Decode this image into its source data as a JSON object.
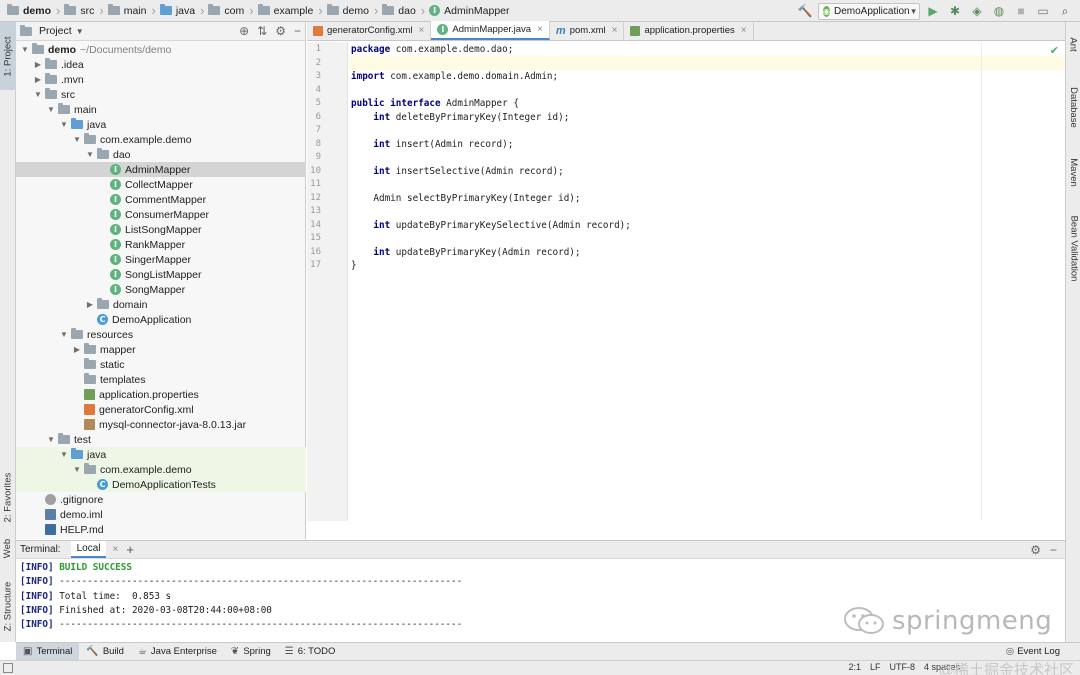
{
  "breadcrumbs": [
    "demo",
    "src",
    "main",
    "java",
    "com",
    "example",
    "demo",
    "dao",
    "AdminMapper"
  ],
  "run_config": "DemoApplication",
  "left_strip": {
    "project": "1: Project",
    "favorites": "2: Favorites",
    "web": "Web",
    "structure": "Z: Structure"
  },
  "right_strip": {
    "ant": "Ant",
    "database": "Database",
    "maven": "Maven",
    "bean": "Bean Validation"
  },
  "project_panel": {
    "title": "Project"
  },
  "tree": [
    {
      "label": "demo",
      "path": "~/Documents/demo",
      "indent": 0,
      "toggle": "open",
      "icon": "folder",
      "bold": true
    },
    {
      "label": ".idea",
      "indent": 1,
      "toggle": "closed",
      "icon": "folder"
    },
    {
      "label": ".mvn",
      "indent": 1,
      "toggle": "closed",
      "icon": "folder"
    },
    {
      "label": "src",
      "indent": 1,
      "toggle": "open",
      "icon": "folder"
    },
    {
      "label": "main",
      "indent": 2,
      "toggle": "open",
      "icon": "folder"
    },
    {
      "label": "java",
      "indent": 3,
      "toggle": "open",
      "icon": "folder-blue"
    },
    {
      "label": "com.example.demo",
      "indent": 4,
      "toggle": "open",
      "icon": "folder-pkg"
    },
    {
      "label": "dao",
      "indent": 5,
      "toggle": "open",
      "icon": "folder-pkg"
    },
    {
      "label": "AdminMapper",
      "indent": 6,
      "toggle": "none",
      "icon": "interface",
      "selected": true
    },
    {
      "label": "CollectMapper",
      "indent": 6,
      "toggle": "none",
      "icon": "interface"
    },
    {
      "label": "CommentMapper",
      "indent": 6,
      "toggle": "none",
      "icon": "interface"
    },
    {
      "label": "ConsumerMapper",
      "indent": 6,
      "toggle": "none",
      "icon": "interface"
    },
    {
      "label": "ListSongMapper",
      "indent": 6,
      "toggle": "none",
      "icon": "interface"
    },
    {
      "label": "RankMapper",
      "indent": 6,
      "toggle": "none",
      "icon": "interface"
    },
    {
      "label": "SingerMapper",
      "indent": 6,
      "toggle": "none",
      "icon": "interface"
    },
    {
      "label": "SongListMapper",
      "indent": 6,
      "toggle": "none",
      "icon": "interface"
    },
    {
      "label": "SongMapper",
      "indent": 6,
      "toggle": "none",
      "icon": "interface"
    },
    {
      "label": "domain",
      "indent": 5,
      "toggle": "closed",
      "icon": "folder-pkg"
    },
    {
      "label": "DemoApplication",
      "indent": 5,
      "toggle": "none",
      "icon": "class"
    },
    {
      "label": "resources",
      "indent": 3,
      "toggle": "open",
      "icon": "folder"
    },
    {
      "label": "mapper",
      "indent": 4,
      "toggle": "closed",
      "icon": "folder"
    },
    {
      "label": "static",
      "indent": 4,
      "toggle": "none",
      "icon": "folder"
    },
    {
      "label": "templates",
      "indent": 4,
      "toggle": "none",
      "icon": "folder"
    },
    {
      "label": "application.properties",
      "indent": 4,
      "toggle": "none",
      "icon": "properties"
    },
    {
      "label": "generatorConfig.xml",
      "indent": 4,
      "toggle": "none",
      "icon": "xml"
    },
    {
      "label": "mysql-connector-java-8.0.13.jar",
      "indent": 4,
      "toggle": "none",
      "icon": "jar"
    },
    {
      "label": "test",
      "indent": 2,
      "toggle": "open",
      "icon": "folder"
    },
    {
      "label": "java",
      "indent": 3,
      "toggle": "open",
      "icon": "folder-blue",
      "test": true
    },
    {
      "label": "com.example.demo",
      "indent": 4,
      "toggle": "open",
      "icon": "folder-pkg",
      "test": true
    },
    {
      "label": "DemoApplicationTests",
      "indent": 5,
      "toggle": "none",
      "icon": "class",
      "test": true
    },
    {
      "label": ".gitignore",
      "indent": 1,
      "toggle": "none",
      "icon": "git"
    },
    {
      "label": "demo.iml",
      "indent": 1,
      "toggle": "none",
      "icon": "iml"
    },
    {
      "label": "HELP.md",
      "indent": 1,
      "toggle": "none",
      "icon": "md"
    }
  ],
  "editor_tabs": [
    {
      "label": "generatorConfig.xml",
      "icon": "xml",
      "active": false
    },
    {
      "label": "AdminMapper.java",
      "icon": "interface",
      "active": true
    },
    {
      "label": "pom.xml",
      "icon": "maven",
      "active": false
    },
    {
      "label": "application.properties",
      "icon": "properties",
      "active": false
    }
  ],
  "code_lines": [
    [
      {
        "t": "package",
        "kw": true
      },
      {
        "t": " com.example.demo.dao;"
      }
    ],
    [],
    [
      {
        "t": "import",
        "kw": true
      },
      {
        "t": " com.example.demo.domain.Admin;"
      }
    ],
    [],
    [
      {
        "t": "public",
        "kw": true
      },
      {
        "t": " "
      },
      {
        "t": "interface",
        "kw": true
      },
      {
        "t": " AdminMapper {"
      }
    ],
    [
      {
        "t": "    "
      },
      {
        "t": "int",
        "kw": true
      },
      {
        "t": " deleteByPrimaryKey(Integer id);"
      }
    ],
    [],
    [
      {
        "t": "    "
      },
      {
        "t": "int",
        "kw": true
      },
      {
        "t": " insert(Admin record);"
      }
    ],
    [],
    [
      {
        "t": "    "
      },
      {
        "t": "int",
        "kw": true
      },
      {
        "t": " insertSelective(Admin record);"
      }
    ],
    [],
    [
      {
        "t": "    Admin selectByPrimaryKey(Integer id);"
      }
    ],
    [],
    [
      {
        "t": "    "
      },
      {
        "t": "int",
        "kw": true
      },
      {
        "t": " updateByPrimaryKeySelective(Admin record);"
      }
    ],
    [],
    [
      {
        "t": "    "
      },
      {
        "t": "int",
        "kw": true
      },
      {
        "t": " updateByPrimaryKey(Admin record);"
      }
    ],
    [
      {
        "t": "}"
      }
    ]
  ],
  "terminal": {
    "title": "Terminal:",
    "tab": "Local",
    "lines": [
      {
        "tag": "[INFO]",
        "text": " BUILD SUCCESS",
        "success": true
      },
      {
        "tag": "[INFO]",
        "text": " ------------------------------------------------------------------------"
      },
      {
        "tag": "[INFO]",
        "text": " Total time:  0.853 s"
      },
      {
        "tag": "[INFO]",
        "text": " Finished at: 2020-03-08T20:44:00+08:00"
      },
      {
        "tag": "[INFO]",
        "text": " ------------------------------------------------------------------------"
      }
    ]
  },
  "bottom_tools": [
    {
      "label": "Terminal",
      "icon": "terminal-icon",
      "active": true
    },
    {
      "label": "Build",
      "icon": "hammer-icon",
      "active": false
    },
    {
      "label": "Java Enterprise",
      "icon": "java-enterprise-icon",
      "active": false
    },
    {
      "label": "Spring",
      "icon": "spring-icon",
      "active": false
    },
    {
      "label": "6: TODO",
      "icon": "todo-icon",
      "active": false
    }
  ],
  "event_log": "Event Log",
  "status": {
    "position": "2:1",
    "line_sep": "LF",
    "encoding": "UTF-8",
    "indent": "4 spaces"
  },
  "watermark": {
    "text": "springmeng",
    "bottom": "@稀土掘金技术社区"
  }
}
